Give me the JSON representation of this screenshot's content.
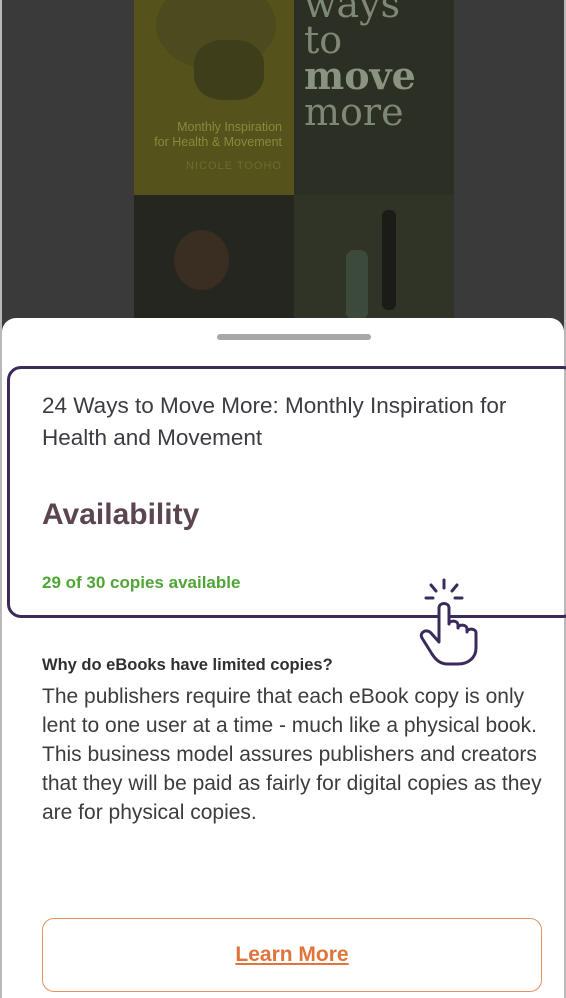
{
  "cover": {
    "title_line1": "ways",
    "title_line2": "to",
    "title_line3": "move",
    "title_line4": "more",
    "subtitle_line1": "Monthly Inspiration",
    "subtitle_line2": "for Health & Movement",
    "author": "NICOLE TOOHO"
  },
  "book": {
    "title": "24 Ways to Move More: Monthly Inspiration for Health and Movement"
  },
  "availability": {
    "heading": "Availability",
    "copies_text": "29 of 30 copies available",
    "copies_available": 29,
    "copies_total": 30,
    "accent_color": "#4fa536"
  },
  "info": {
    "heading": "Why do eBooks have limited copies?",
    "body": "The publishers require that each eBook copy is only lent to one user at a time - much like a physical book. This business model assures publishers and creators that they will be paid as fairly for digital copies as they are for physical copies."
  },
  "actions": {
    "learn_more_label": "Learn More",
    "accent_color": "#e0743a"
  },
  "highlight_color": "#3b2a5c"
}
